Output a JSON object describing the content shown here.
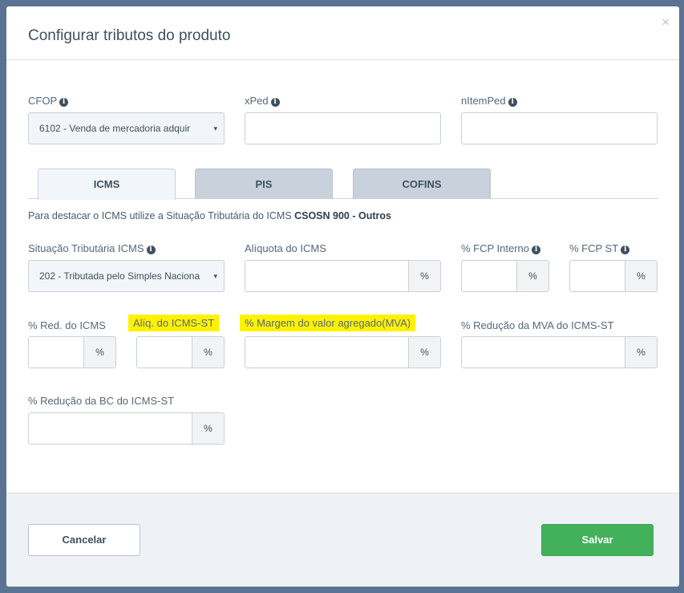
{
  "modal": {
    "title": "Configurar tributos do produto",
    "close": "×"
  },
  "top_fields": {
    "cfop_label": "CFOP",
    "cfop_value": "6102 - Venda de mercadoria adquir",
    "xped_label": "xPed",
    "xped_value": "",
    "nitemped_label": "nItemPed",
    "nitemped_value": ""
  },
  "tabs": [
    {
      "label": "ICMS",
      "active": true
    },
    {
      "label": "PIS",
      "active": false
    },
    {
      "label": "COFINS",
      "active": false
    }
  ],
  "notice": {
    "text": "Para destacar o ICMS utilize a Situação Tributária do ICMS ",
    "bold": "CSOSN 900 - Outros"
  },
  "icms": {
    "situacao_label": "Situação Tributária ICMS",
    "situacao_value": "202 - Tributada pelo Simples Naciona",
    "aliquota_label": "Alíquota do ICMS",
    "fcp_interno_label": "% FCP Interno",
    "fcp_st_label": "% FCP ST",
    "red_icms_label": "% Red. do ICMS",
    "aliq_icms_st_label": "Alíq. do ICMS-ST",
    "mva_label": "% Margem do valor agregado(MVA)",
    "red_mva_label": "% Redução da MVA do ICMS-ST",
    "red_bc_label": "% Redução da BC do ICMS-ST",
    "percent_unit": "%"
  },
  "icons": {
    "info": "i",
    "caret": "▾"
  },
  "footer": {
    "cancel_label": "Cancelar",
    "save_label": "Salvar"
  },
  "colors": {
    "save_button": "#43b05b",
    "highlight": "#fff200",
    "backdrop": "#5b7393"
  }
}
